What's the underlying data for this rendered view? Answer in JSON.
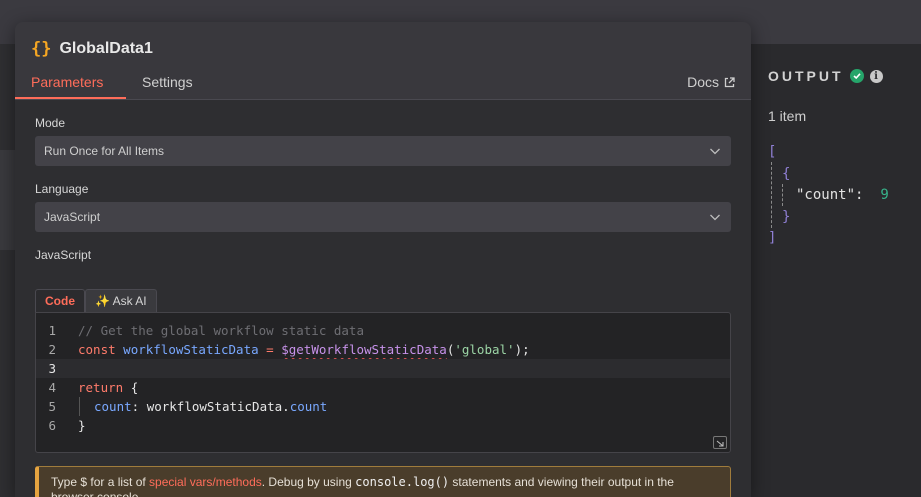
{
  "node": {
    "icon": "braces-icon",
    "title": "GlobalData1"
  },
  "tabs": [
    {
      "label": "Parameters",
      "active": true
    },
    {
      "label": "Settings",
      "active": false
    }
  ],
  "docs": {
    "label": "Docs",
    "icon": "external-link-icon"
  },
  "mode": {
    "label": "Mode",
    "value": "Run Once for All Items"
  },
  "language": {
    "label": "Language",
    "value": "JavaScript"
  },
  "editor": {
    "label": "JavaScript",
    "tabs": {
      "code": "Code",
      "ask_ai": "✨ Ask AI"
    },
    "line_numbers": [
      "1",
      "2",
      "3",
      "4",
      "5",
      "6"
    ],
    "lines": {
      "l1_comment": "// Get the global workflow static data",
      "l2_const": "const",
      "l2_var": "workflowStaticData",
      "l2_eq": "=",
      "l2_fn": "$getWorkflowStaticData",
      "l2_open": "(",
      "l2_str": "'global'",
      "l2_close": ");",
      "l4_return": "return",
      "l4_brace": "{",
      "l5_prop": "count",
      "l5_colon": ":",
      "l5_obj": "workflowStaticData.",
      "l5_member": "count",
      "l6_brace": "}"
    }
  },
  "hint": {
    "pre": "Type $ for a list of ",
    "link": "special vars/methods",
    "mid": ". Debug by using ",
    "code": "console.log()",
    "post": " statements and viewing their output in the browser console."
  },
  "output": {
    "title": "OUTPUT",
    "status_icon": "check-circle-icon",
    "info_icon": "info-icon",
    "item_count": "1 item",
    "json": {
      "open_bracket": "[",
      "open_brace": "{",
      "key": "\"count\"",
      "colon": ":",
      "value": "9",
      "close_brace": "}",
      "close_bracket": "]"
    }
  },
  "colors": {
    "accent": "#ff6d5a",
    "success": "#25a56a",
    "warning": "#e6a440"
  }
}
